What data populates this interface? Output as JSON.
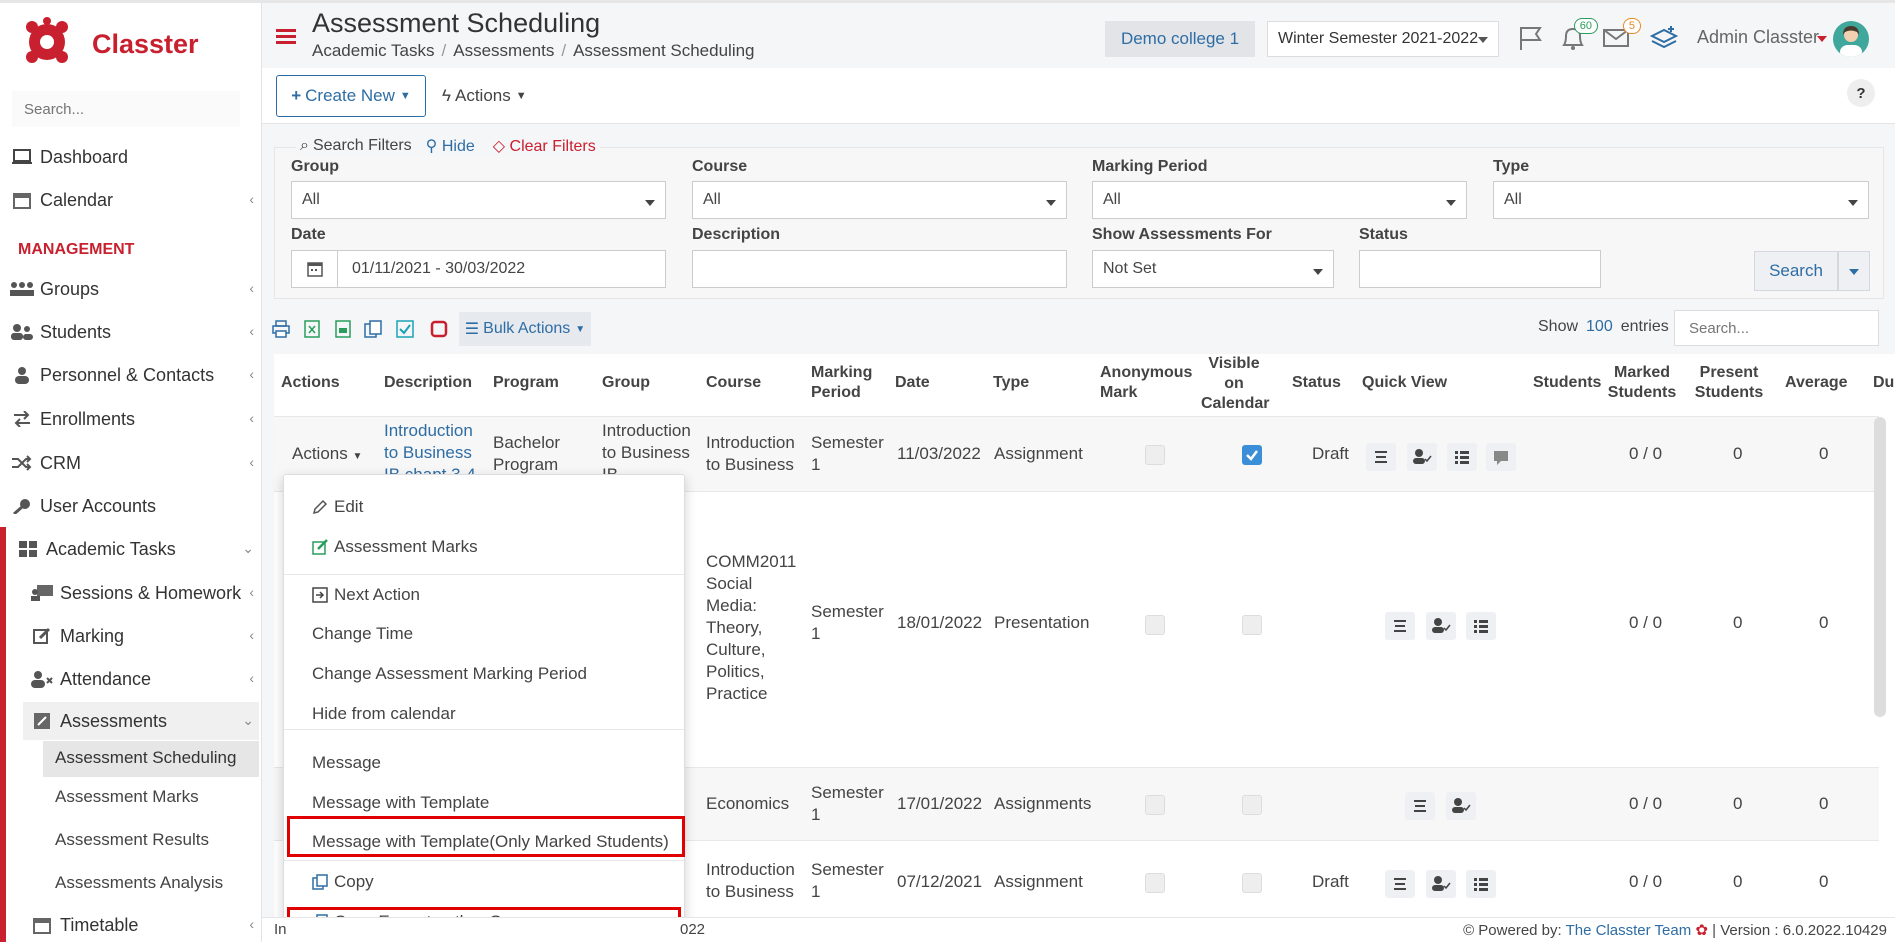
{
  "app": {
    "brand": "Classter"
  },
  "sidebar": {
    "search_placeholder": "Search...",
    "items": [
      {
        "label": "Dashboard"
      },
      {
        "label": "Calendar"
      },
      {
        "label": "Groups"
      },
      {
        "label": "Students"
      },
      {
        "label": "Personnel & Contacts"
      },
      {
        "label": "Enrollments"
      },
      {
        "label": "CRM"
      },
      {
        "label": "User Accounts"
      },
      {
        "label": "Academic Tasks"
      },
      {
        "label": "Sessions & Homework"
      },
      {
        "label": "Marking"
      },
      {
        "label": "Attendance"
      },
      {
        "label": "Assessments"
      },
      {
        "label": "Timetable"
      }
    ],
    "section_label": "MANAGEMENT",
    "sub_items": [
      "Assessment Scheduling",
      "Assessment Marks",
      "Assessment Results",
      "Assessments Analysis"
    ]
  },
  "header": {
    "title": "Assessment Scheduling",
    "breadcrumb": [
      "Academic Tasks",
      "Assessments",
      "Assessment Scheduling"
    ],
    "college": "Demo college 1",
    "semester": "Winter Semester 2021-2022",
    "notif_count": "60",
    "msg_count": "5",
    "user": "Admin Classter"
  },
  "toolbar": {
    "create_label": "Create New",
    "actions_label": "Actions",
    "help_label": "?"
  },
  "filters": {
    "legend": "Search Filters",
    "hide": "Hide",
    "clear": "Clear Filters",
    "group_label": "Group",
    "group_value": "All",
    "course_label": "Course",
    "course_value": "All",
    "mp_label": "Marking Period",
    "mp_value": "All",
    "type_label": "Type",
    "type_value": "All",
    "date_label": "Date",
    "date_value": "01/11/2021 - 30/03/2022",
    "desc_label": "Description",
    "show_label": "Show Assessments For",
    "show_value": "Not Set",
    "status_label": "Status",
    "search_label": "Search"
  },
  "table_toolbar": {
    "bulk": "Bulk Actions",
    "show": "Show",
    "entries_count": "100",
    "entries": "entries",
    "search_placeholder": "Search..."
  },
  "table": {
    "headers": [
      "Actions",
      "Description",
      "Program",
      "Group",
      "Course",
      "Marking Period",
      "Date",
      "Type",
      "Anonymous Mark",
      "Visible on Calendar",
      "Status",
      "Quick View",
      "Students",
      "Marked Students",
      "Present Students",
      "Average",
      "Du"
    ],
    "rows": [
      {
        "actions": "Actions",
        "description": "Introduction to Business IB chapt 3-4",
        "program": "Bachelor Program",
        "group": "Introduction to Business IB",
        "course": "Introduction to Business",
        "mp": "Semester 1",
        "date": "11/03/2022",
        "type": "Assignment",
        "status": "Draft",
        "marked": "0 / 0",
        "present": "0",
        "average": "0"
      },
      {
        "course": "COMM2011 Social Media: Theory, Culture, Politics, Practice",
        "mp": "Semester 1",
        "date": "18/01/2022",
        "type": "Presentation",
        "status": "",
        "marked": "0 / 0",
        "present": "0",
        "average": "0"
      },
      {
        "course": "Economics",
        "mp": "Semester 1",
        "date": "17/01/2022",
        "type": "Assignments",
        "status": "",
        "marked": "0 / 0",
        "present": "0",
        "average": "0"
      },
      {
        "course": "Introduction to Business",
        "mp": "Semester 1",
        "date": "07/12/2021",
        "type": "Assignment",
        "status": "Draft",
        "marked": "0 / 0",
        "present": "0",
        "average": "0"
      }
    ]
  },
  "menu": {
    "items": [
      "Edit",
      "Assessment Marks",
      "Next Action",
      "Change Time",
      "Change Assessment Marking Period",
      "Hide from calendar",
      "Message",
      "Message with Template",
      "Message with Template(Only Marked Students)",
      "Copy",
      "Copy Exam to other Groups"
    ]
  },
  "footer": {
    "left": "In",
    "left2": "022",
    "powered": "Powered by:",
    "team": "The Classter Team",
    "version": "| Version : 6.0.2022.10429"
  },
  "colors": {
    "brand": "#c8202f",
    "link": "#2e6da4",
    "highlight": "#e10000"
  }
}
